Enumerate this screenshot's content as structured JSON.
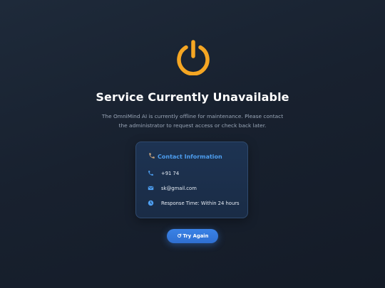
{
  "page": {
    "title": "Service Currently Unavailable",
    "description": "The OmniMind AI is currently offline for maintenance. Please contact the administrator to request access or check back later."
  },
  "contact": {
    "heading": "Contact Information",
    "phone": "+91 74",
    "email": "sk@gmail.com",
    "response_time": "Response Time: Within 24 hours"
  },
  "actions": {
    "retry_label": "Try Again"
  },
  "colors": {
    "accent_orange": "#f5a623",
    "accent_blue": "#4d9ef0",
    "button_blue": "#3a82e6",
    "background": "#18212f"
  },
  "icons": {
    "status": "power-icon",
    "heading": "phone-icon",
    "phone": "phone-icon",
    "email": "envelope-icon",
    "time": "clock-icon",
    "retry": "refresh-icon"
  }
}
